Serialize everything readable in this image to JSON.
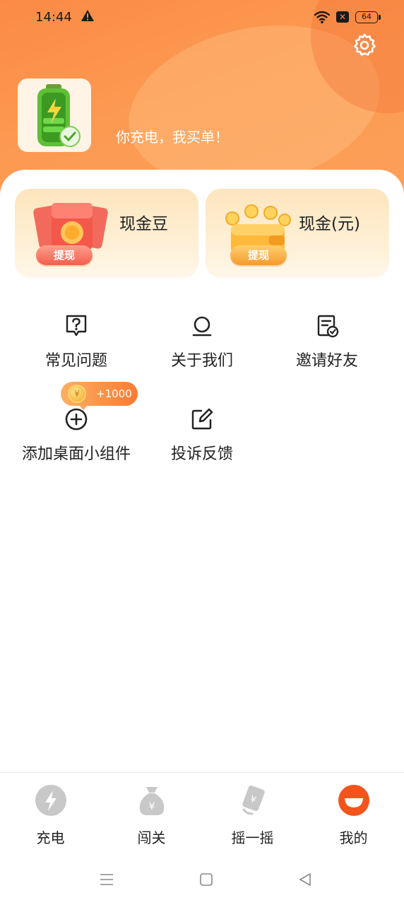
{
  "status_bar": {
    "time": "14:44",
    "battery": "64",
    "notification_badge": "✕"
  },
  "header": {
    "slogan": "你充电，我买单！",
    "settings_icon": "gear-icon",
    "avatar_icon": "battery-charging-icon"
  },
  "wallet": {
    "cash_beans": {
      "title": "现金豆",
      "button": "提现"
    },
    "cash_yuan": {
      "title": "现金(元)",
      "button": "提现"
    }
  },
  "menu": {
    "faq": "常见问题",
    "about": "关于我们",
    "invite": "邀请好友",
    "add_widget": "添加桌面小组件",
    "feedback": "投诉反馈",
    "reward_badge": "+1000",
    "coin_symbol": "¥"
  },
  "tabs": [
    {
      "label": "充电",
      "icon": "lightning-icon",
      "active": false
    },
    {
      "label": "闯关",
      "icon": "money-bag-icon",
      "active": false
    },
    {
      "label": "摇一摇",
      "icon": "shake-icon",
      "active": false
    },
    {
      "label": "我的",
      "icon": "profile-icon",
      "active": true
    }
  ],
  "colors": {
    "accent": "#fb8a45",
    "active_tab": "#f4541c",
    "inactive_tab": "#c8c8c8"
  }
}
